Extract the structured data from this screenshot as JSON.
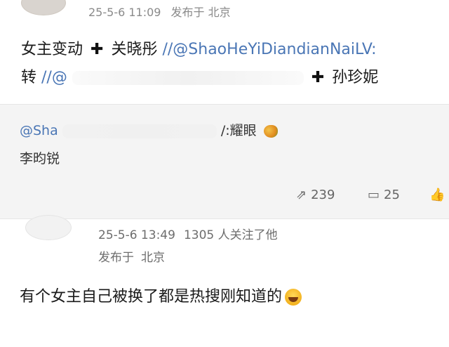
{
  "post1": {
    "date": "25-5-6 11:09",
    "published_in": "发布于",
    "location": "北京",
    "line1": {
      "text_a": "女主变动",
      "plus": "✚",
      "text_b": "关晓彤",
      "sep": "//",
      "handle": "@ShaoHeYiDiandianNaiLV:"
    },
    "line2": {
      "text_a": "转",
      "sep": "//",
      "handle_partial": "@",
      "plus": "✚",
      "text_b": "孙珍妮"
    }
  },
  "repost": {
    "handle_partial": "@Sha",
    "suffix": "/:耀眼",
    "text": "李昀锐",
    "reposts": "239",
    "comments": "25"
  },
  "post2": {
    "date": "25-5-6 13:49",
    "followers": "1305 人关注了他",
    "published_in": "发布于",
    "location": "北京",
    "body": "有个女主自己被换了都是热搜刚知道的"
  },
  "icons": {
    "repost": "repost-icon",
    "comment": "comment-icon",
    "like": "like-icon",
    "mango": "mango-emoji-icon",
    "laugh": "laugh-cry-emoji-icon"
  }
}
